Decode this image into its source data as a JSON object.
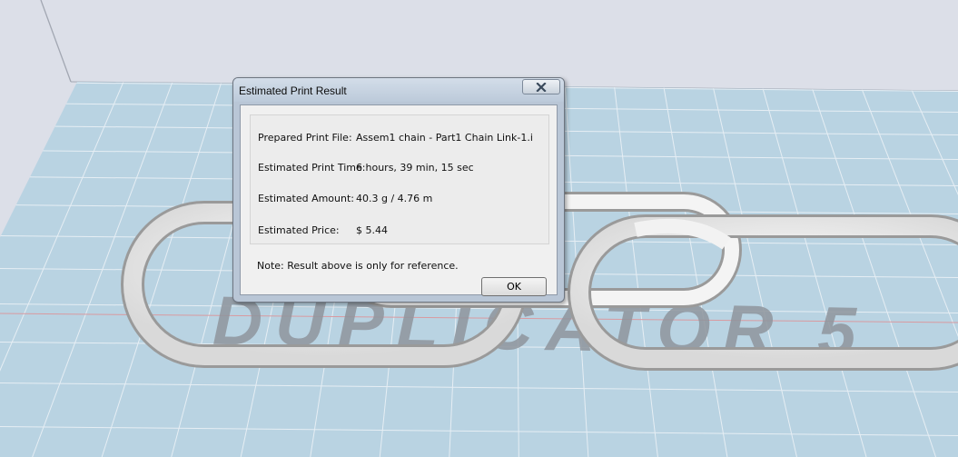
{
  "scene": {
    "watermark": "DUPLICATOR 5",
    "bed_color": "#b9d3e2",
    "background_color": "#dcdfe8",
    "object": "chain-links"
  },
  "dialog": {
    "title": "Estimated Print Result",
    "fields": [
      {
        "label": "Prepared Print File:",
        "value": "Assem1 chain - Part1 Chain Link-1.i"
      },
      {
        "label": "Estimated Print Time:",
        "value": "6 hours, 39 min, 15 sec"
      },
      {
        "label": "Estimated Amount:",
        "value": "40.3 g / 4.76 m"
      },
      {
        "label": "Estimated Price:",
        "value": "$ 5.44"
      }
    ],
    "note": "Note: Result above is only for reference.",
    "ok_label": "OK"
  }
}
